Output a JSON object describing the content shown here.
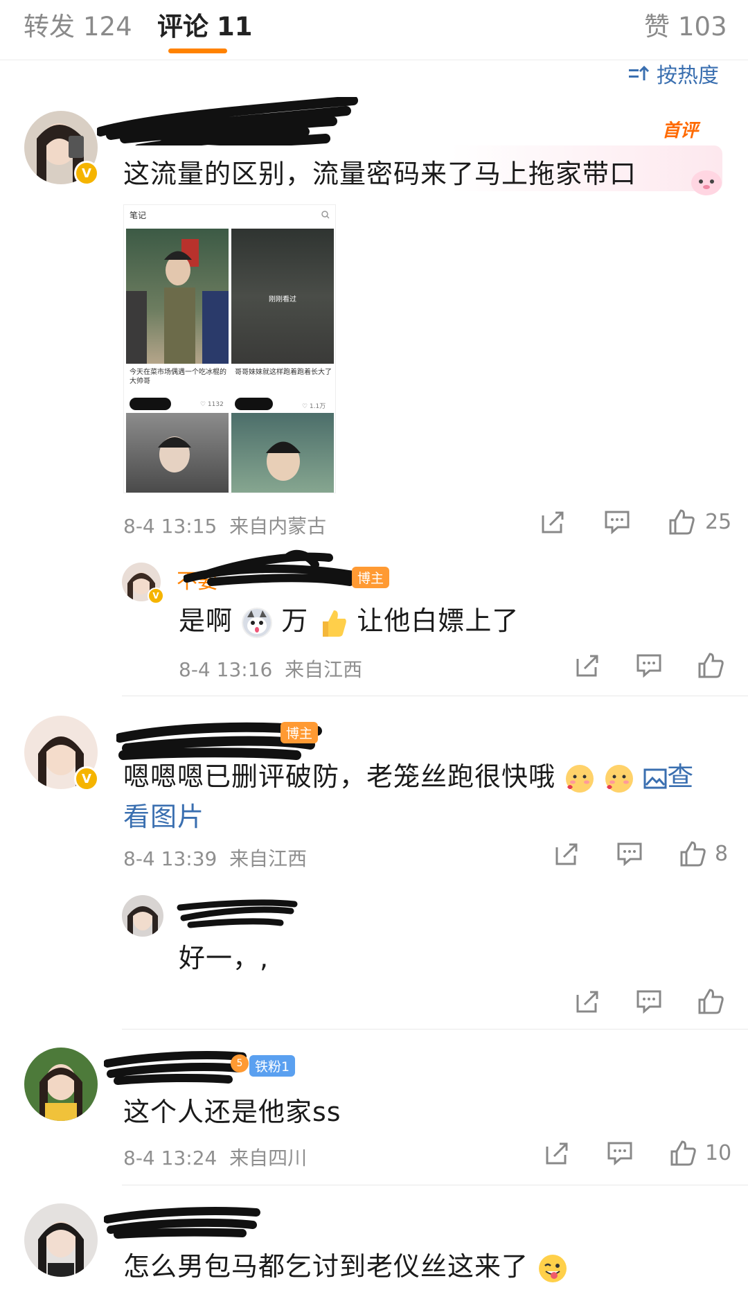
{
  "tabs": [
    {
      "label": "转发",
      "count": "124"
    },
    {
      "label": "评论",
      "count": "11"
    },
    {
      "label": "赞",
      "count": "103"
    }
  ],
  "sort_label": "按热度",
  "hot_badge": "首评",
  "comments": [
    {
      "text": "这流量的区别，流量密码来了马上拖家带口",
      "embed": {
        "header": "笔记",
        "overlay": "刚刚看过",
        "captions": [
          "今天在菜市场偶遇一个吃冰棍的大帅哥",
          "哥哥妹妹就这样跑着跑着长大了"
        ],
        "likes": [
          "♡ 1132",
          "♡ 1.1万"
        ]
      },
      "time": "8-4 13:15",
      "location": "来自内蒙古",
      "likes": "25"
    },
    {
      "tag": "博主",
      "text_before": "是啊",
      "text_mid": " 万",
      "text_after": "让他白嫖上了",
      "time": "8-4 13:16",
      "location": "来自江西",
      "likes": ""
    },
    {
      "tag": "博主",
      "text": "嗯嗯嗯已删评破防，老笼丝跑很快哦",
      "link1": "查",
      "link2": "看图片",
      "time": "8-4 13:39",
      "location": "来自江西",
      "likes": "8"
    },
    {
      "text": "好一，,",
      "likes": ""
    },
    {
      "tag": "铁粉1",
      "tag_level": "5",
      "text": "这个人还是他家ss",
      "time": "8-4 13:24",
      "location": "来自四川",
      "likes": "10"
    },
    {
      "text": "怎么男包马都乞讨到老仪丝这来了"
    }
  ],
  "colors": {
    "accent": "#ff8200",
    "link": "#3a6fb0",
    "meta": "#8f8f8f",
    "redaction": "#111111"
  }
}
